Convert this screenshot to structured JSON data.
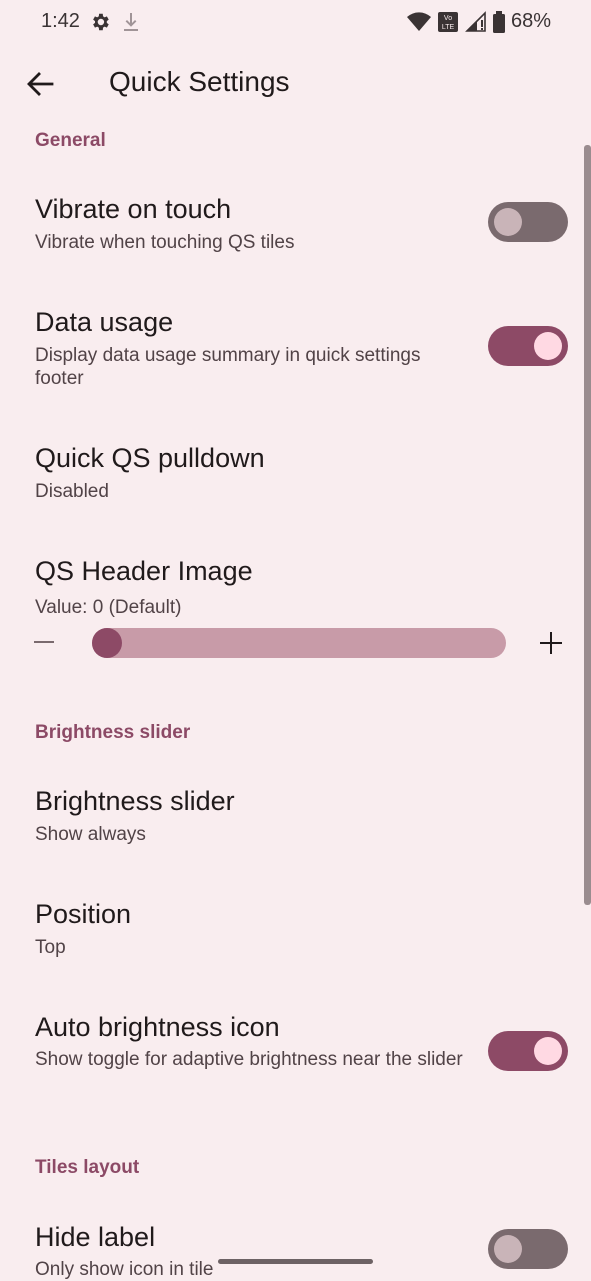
{
  "status": {
    "time": "1:42",
    "battery": "68%",
    "volte": "Vo LTE"
  },
  "appbar": {
    "title": "Quick Settings"
  },
  "sections": {
    "general": "General",
    "brightness": "Brightness slider",
    "tiles": "Tiles layout"
  },
  "items": {
    "vibrate": {
      "title": "Vibrate on touch",
      "summary": "Vibrate when touching QS tiles",
      "checked": false
    },
    "data_usage": {
      "title": "Data usage",
      "summary": "Display data usage summary in quick settings footer",
      "checked": true
    },
    "pulldown": {
      "title": "Quick QS pulldown",
      "summary": "Disabled"
    },
    "header_image": {
      "title": "QS Header Image",
      "summary": "Value: 0 (Default)",
      "value": 0
    },
    "brightness_slider": {
      "title": "Brightness slider",
      "summary": "Show always"
    },
    "position": {
      "title": "Position",
      "summary": "Top"
    },
    "auto_brightness": {
      "title": "Auto brightness icon",
      "summary": "Show toggle for adaptive brightness near the slider",
      "checked": true
    },
    "hide_label": {
      "title": "Hide label",
      "summary": "Only show icon in tile",
      "checked": false
    }
  },
  "colors": {
    "background": "#f9edef",
    "accent": "#8d4a66",
    "track": "#c89ba8"
  }
}
